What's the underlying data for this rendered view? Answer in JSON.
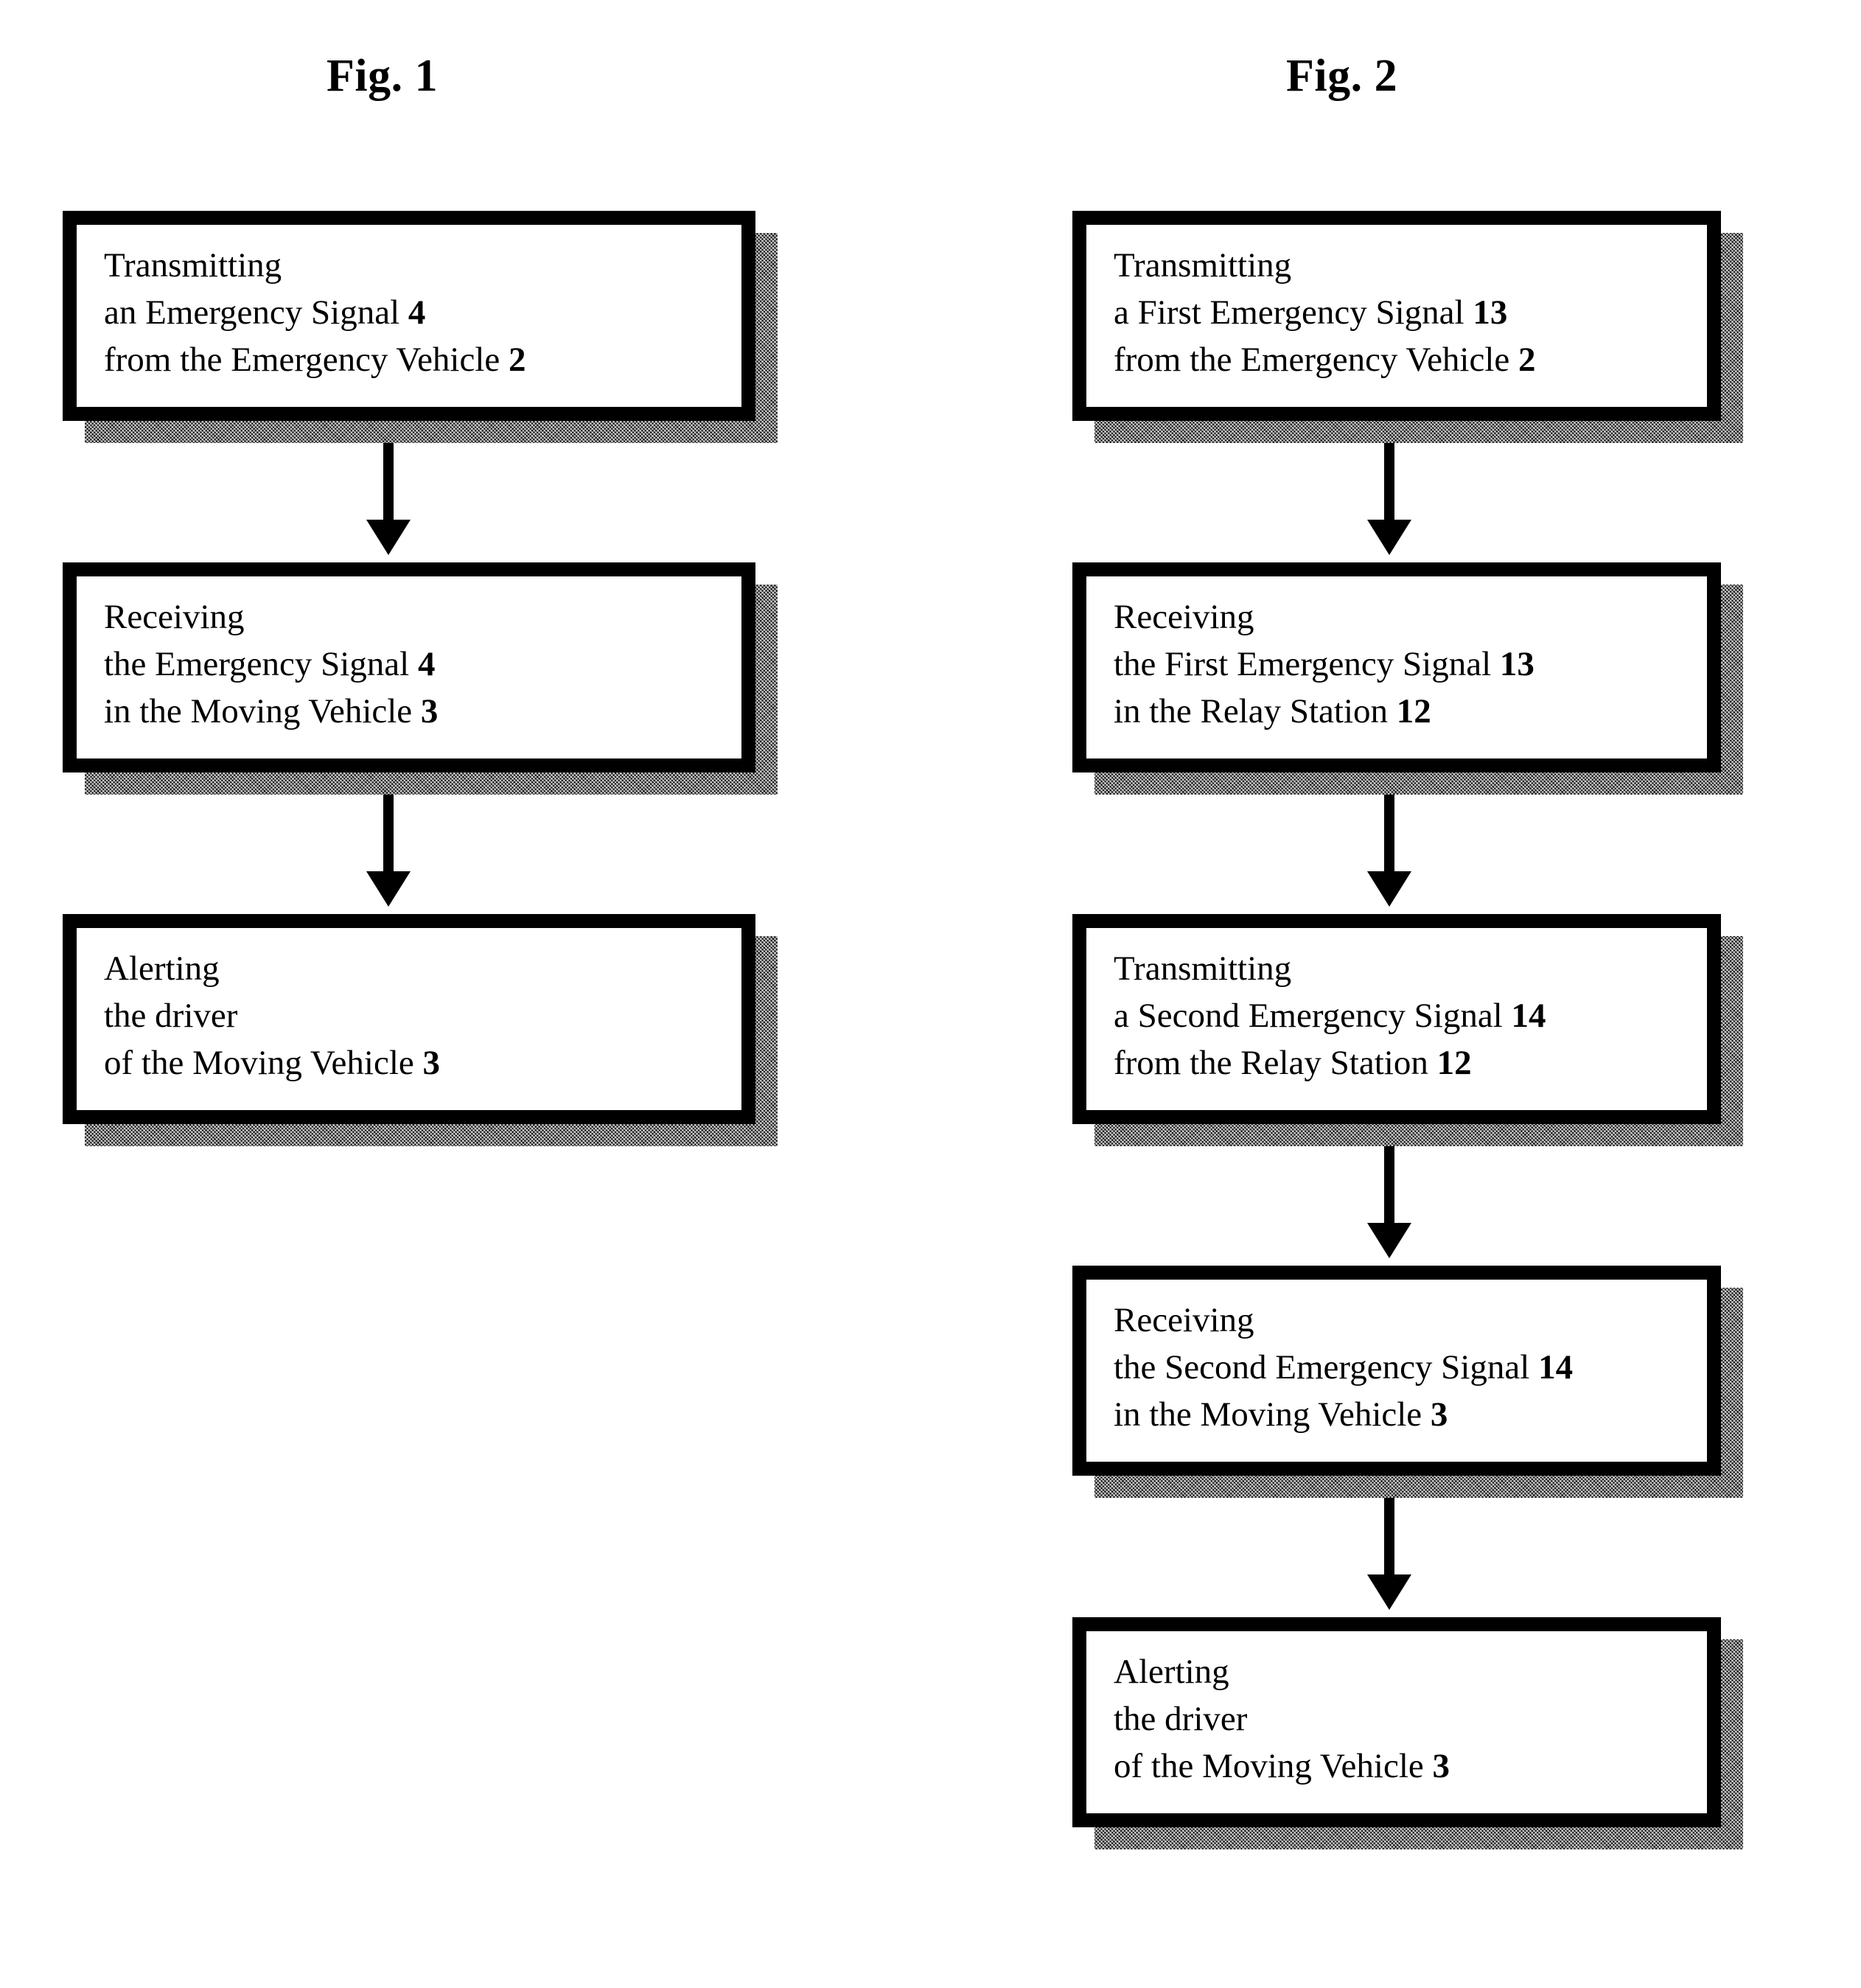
{
  "figures": [
    {
      "id": "fig1",
      "title": "Fig. 1",
      "nodes": [
        {
          "name": "transmitting-emergency-signal",
          "lines": [
            {
              "text": "Transmitting",
              "ref": ""
            },
            {
              "text": "an Emergency Signal ",
              "ref": "4"
            },
            {
              "text": "from the Emergency Vehicle ",
              "ref": "2"
            }
          ]
        },
        {
          "name": "receiving-emergency-signal",
          "lines": [
            {
              "text": "Receiving",
              "ref": ""
            },
            {
              "text": "the Emergency Signal ",
              "ref": "4"
            },
            {
              "text": "in the Moving Vehicle ",
              "ref": "3"
            }
          ]
        },
        {
          "name": "alerting-driver",
          "lines": [
            {
              "text": "Alerting",
              "ref": ""
            },
            {
              "text": "the driver",
              "ref": ""
            },
            {
              "text": "of the Moving Vehicle ",
              "ref": "3"
            }
          ]
        }
      ]
    },
    {
      "id": "fig2",
      "title": "Fig. 2",
      "nodes": [
        {
          "name": "transmitting-first-emergency-signal",
          "lines": [
            {
              "text": "Transmitting",
              "ref": ""
            },
            {
              "text": "a First Emergency Signal ",
              "ref": "13"
            },
            {
              "text": "from the Emergency Vehicle ",
              "ref": "2"
            }
          ]
        },
        {
          "name": "receiving-first-emergency-signal",
          "lines": [
            {
              "text": "Receiving",
              "ref": ""
            },
            {
              "text": "the First Emergency Signal ",
              "ref": "13"
            },
            {
              "text": "in the Relay Station ",
              "ref": "12"
            }
          ]
        },
        {
          "name": "transmitting-second-emergency-signal",
          "lines": [
            {
              "text": "Transmitting",
              "ref": ""
            },
            {
              "text": "a Second Emergency Signal ",
              "ref": "14"
            },
            {
              "text": "from the Relay Station ",
              "ref": "12"
            }
          ]
        },
        {
          "name": "receiving-second-emergency-signal",
          "lines": [
            {
              "text": "Receiving",
              "ref": ""
            },
            {
              "text": "the Second Emergency Signal ",
              "ref": "14"
            },
            {
              "text": "in the Moving Vehicle ",
              "ref": "3"
            }
          ]
        },
        {
          "name": "alerting-driver",
          "lines": [
            {
              "text": "Alerting",
              "ref": ""
            },
            {
              "text": "the driver",
              "ref": ""
            },
            {
              "text": "of the Moving Vehicle ",
              "ref": "3"
            }
          ]
        }
      ]
    }
  ],
  "colors": {
    "ink": "#000000",
    "paper": "#ffffff",
    "shadow": "#6e6e6e"
  }
}
